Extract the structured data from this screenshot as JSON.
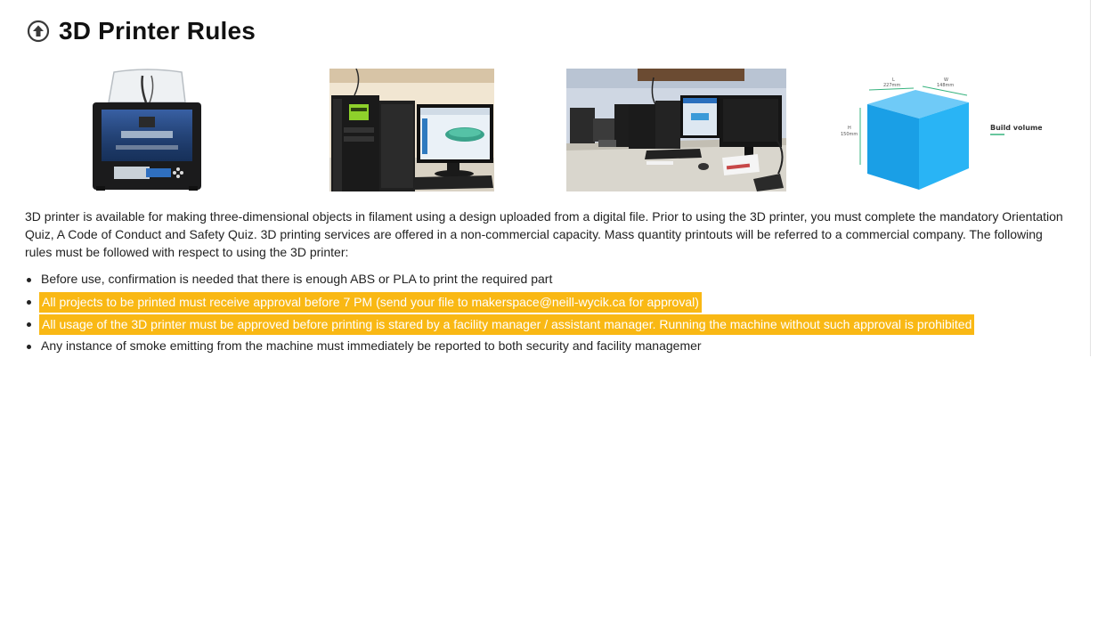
{
  "page": {
    "title": "3D Printer Rules",
    "back_to_top_icon": "circle-arrow-up-icon"
  },
  "images": {
    "printer": {
      "name": "3d-printer-photo"
    },
    "workstation": {
      "name": "workstation-photo"
    },
    "workspace": {
      "name": "workspace-photo"
    },
    "build_volume": {
      "name": "build-volume-diagram",
      "label": "Build volume",
      "length_label": "L",
      "length_value": "227mm",
      "width_label": "W",
      "width_value": "148mm",
      "height_label": "H",
      "height_value": "150mm"
    }
  },
  "description": "3D printer is available for making three-dimensional objects in filament using a design uploaded from a digital file. Prior to using the 3D printer, you must complete the mandatory Orientation Quiz, A Code of Conduct and Safety Quiz. 3D printing services are offered in a non-commercial capacity. Mass quantity printouts will be referred to a commercial company. The following rules must be followed with respect to using the 3D printer:",
  "rules": [
    {
      "text": "Before use, confirmation is needed that there is enough ABS or PLA to print the required part",
      "highlight": false
    },
    {
      "text": "All projects to be printed must receive approval before 7 PM (send your file to makerspace@neill-wycik.ca for approval)",
      "highlight": true
    },
    {
      "text": "All usage of the 3D printer must be approved before printing is stared by a facility manager / assistant manager. Running the machine without such approval is prohibited",
      "highlight": true
    },
    {
      "text": "Any instance of smoke emitting from the machine must immediately be reported to both security and facility managemer",
      "highlight": false
    }
  ],
  "colors": {
    "highlight": "#f9b814",
    "cube_front": "#1a9fe6",
    "cube_top": "#6fcaf7",
    "cube_side": "#29b4f5"
  }
}
